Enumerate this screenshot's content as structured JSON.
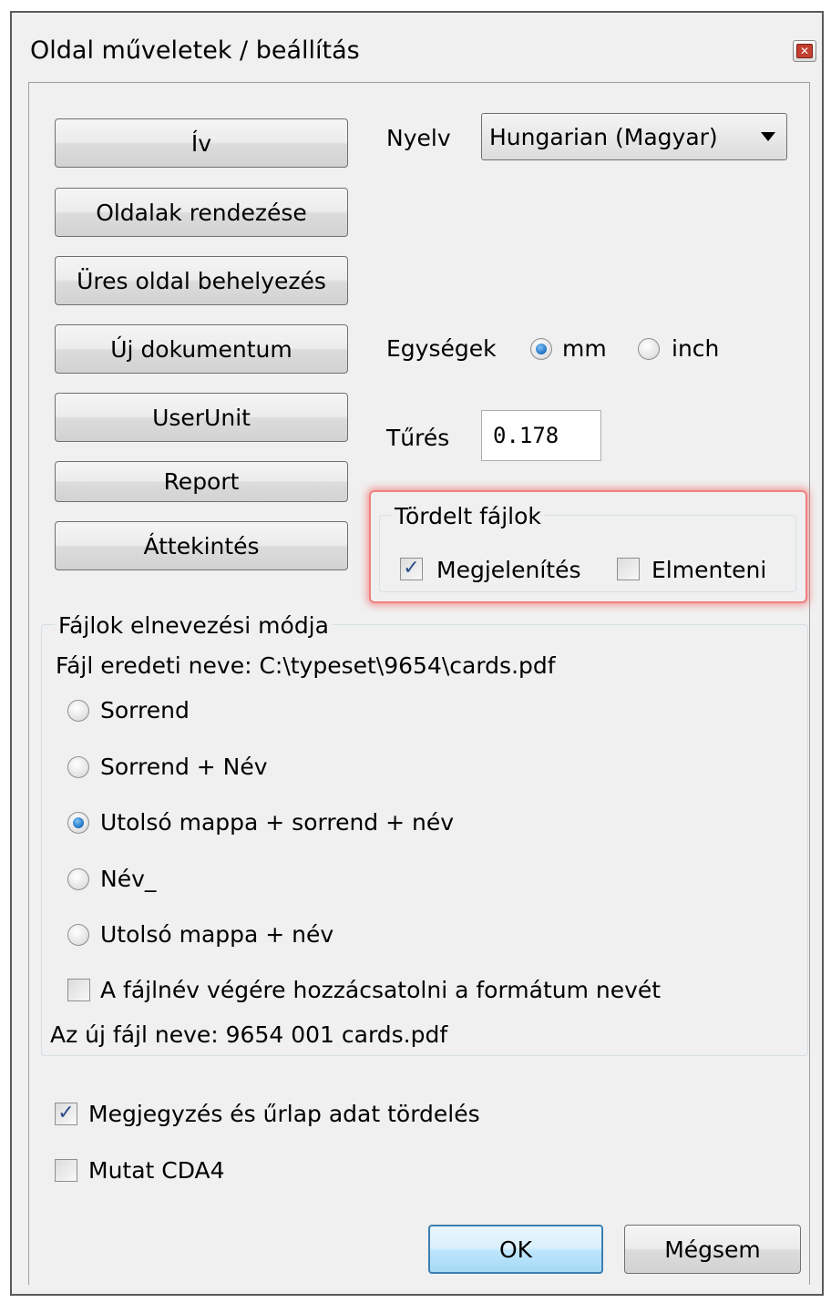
{
  "window": {
    "title": "Oldal műveletek / beállítás",
    "close_icon": "close-icon"
  },
  "left_buttons": [
    {
      "label": "Ív"
    },
    {
      "label": "Oldalak rendezése"
    },
    {
      "label": "Üres oldal behelyezés"
    },
    {
      "label": "Új dokumentum"
    },
    {
      "label": "UserUnit"
    },
    {
      "label": "Report"
    },
    {
      "label": "Áttekintés"
    }
  ],
  "language": {
    "label": "Nyelv",
    "selected": "Hungarian (Magyar)"
  },
  "units": {
    "label": "Egységek",
    "options": [
      {
        "label": "mm",
        "checked": true
      },
      {
        "label": "inch",
        "checked": false
      }
    ]
  },
  "tolerance": {
    "label": "Tűrés",
    "value": "0.178"
  },
  "split_files": {
    "legend": "Tördelt fájlok",
    "show": {
      "label": "Megjelenítés",
      "checked": true
    },
    "save": {
      "label": "Elmenteni",
      "checked": false
    },
    "highlight_color": "#f08080"
  },
  "naming": {
    "legend": "Fájlok elnevezési módja",
    "original_name": "Fájl eredeti neve: C:\\typeset\\9654\\cards.pdf",
    "options": [
      {
        "label": "Sorrend",
        "checked": false
      },
      {
        "label": "Sorrend + Név",
        "checked": false
      },
      {
        "label": "Utolsó mappa + sorrend + név",
        "checked": true
      },
      {
        "label": "Név_",
        "checked": false
      },
      {
        "label": " Utolsó mappa + név",
        "checked": false
      }
    ],
    "append_format": {
      "label": "A fájlnév végére hozzácsatolni a formátum nevét",
      "checked": false
    },
    "new_name": "Az új fájl neve: 9654 001 cards.pdf"
  },
  "annotations": {
    "label": "Megjegyzés és űrlap adat tördelés",
    "checked": true
  },
  "show_cda4": {
    "label": "Mutat CDA4",
    "checked": false
  },
  "footer": {
    "ok_label": "OK",
    "cancel_label": "Mégsem"
  },
  "colors": {
    "dialog_bg": "#f0f0f0",
    "accent": "#3c7fb1"
  }
}
